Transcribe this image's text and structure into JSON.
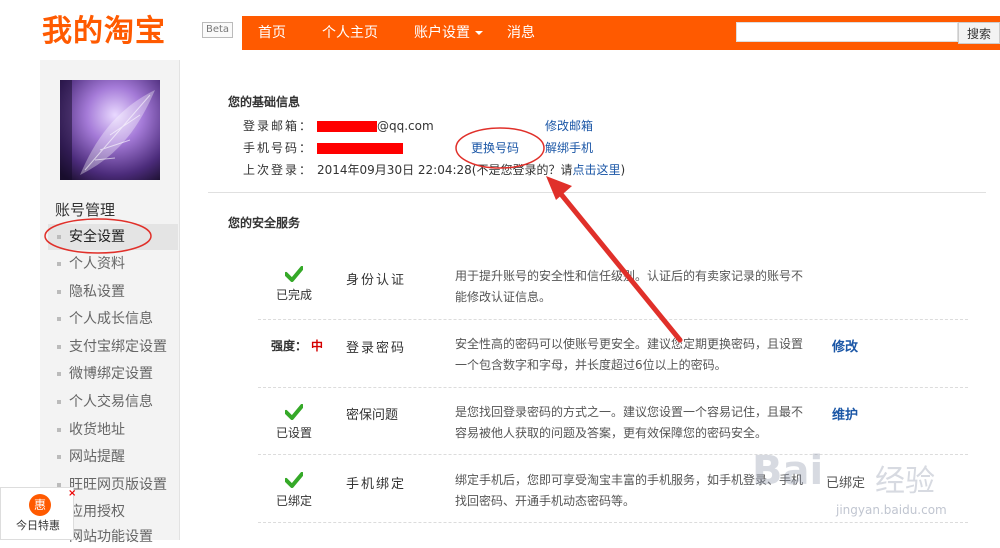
{
  "header": {
    "logo": "我的淘宝",
    "badge": "Beta",
    "nav": [
      {
        "label": "首页"
      },
      {
        "label": "个人主页"
      },
      {
        "label": "账户设置"
      },
      {
        "label": "消息"
      }
    ],
    "search_value": "",
    "search_button": "搜索",
    "brand_color": "#ff5a00"
  },
  "sidebar": {
    "title": "账号管理",
    "items": [
      {
        "label": "安全设置"
      },
      {
        "label": "个人资料"
      },
      {
        "label": "隐私设置"
      },
      {
        "label": "个人成长信息"
      },
      {
        "label": "支付宝绑定设置"
      },
      {
        "label": "微博绑定设置"
      },
      {
        "label": "个人交易信息"
      },
      {
        "label": "收货地址"
      },
      {
        "label": "网站提醒"
      },
      {
        "label": "旺旺网页版设置"
      },
      {
        "label": "应用授权"
      },
      {
        "label": "网站功能设置"
      }
    ]
  },
  "basic_info": {
    "title": "您的基础信息",
    "email_label": "登录邮箱：",
    "email_suffix": "@qq.com",
    "email_action": "修改邮箱",
    "phone_label": "手机号码：",
    "phone_action_change": "更换号码",
    "phone_action_unbind": "解绑手机",
    "last_login_label": "上次登录：",
    "last_login_time": "2014年09月30日 22:04:28",
    "not_me_text": "(不是您登录的？请",
    "not_me_link": "点击这里",
    "not_me_close": ")"
  },
  "security": {
    "title": "您的安全服务",
    "strength_label": "强度：",
    "strength_value": "中",
    "services": [
      {
        "status": "已完成",
        "name": "身份认证",
        "desc": "用于提升账号的安全性和信任级别。认证后的有卖家记录的账号不能修改认证信息。",
        "action": ""
      },
      {
        "status": "",
        "name": "登录密码",
        "desc": "安全性高的密码可以使账号更安全。建议您定期更换密码，且设置一个包含数字和字母，并长度超过6位以上的密码。",
        "action": "修改"
      },
      {
        "status": "已设置",
        "name": "密保问题",
        "desc": "是您找回登录密码的方式之一。建议您设置一个容易记住，且最不容易被他人获取的问题及答案，更有效保障您的密码安全。",
        "action": "维护"
      },
      {
        "status": "已绑定",
        "name": "手机绑定",
        "desc": "绑定手机后，您即可享受淘宝丰富的手机服务，如手机登录、手机找回密码、开通手机动态密码等。",
        "action": "已绑定"
      }
    ]
  },
  "promo": {
    "icon": "惠",
    "close": "×",
    "text": "今日特惠"
  },
  "watermark": {
    "logo": "Bai",
    "text": "经验",
    "url": "jingyan.baidu.com"
  }
}
